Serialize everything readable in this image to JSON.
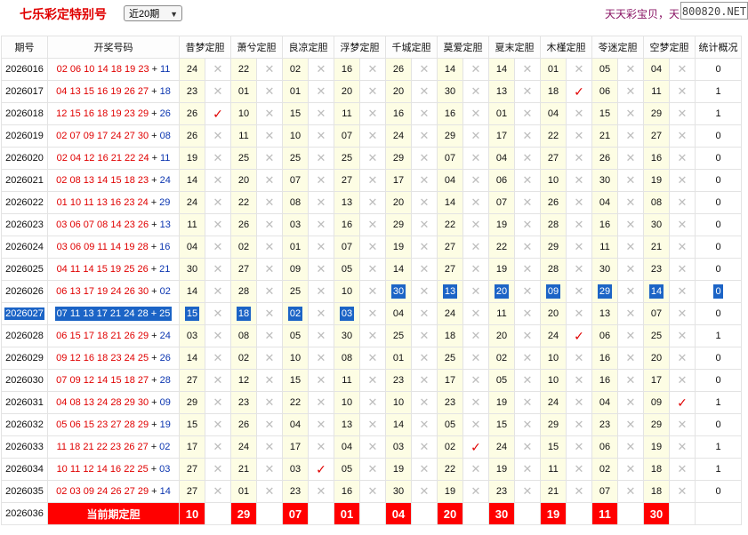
{
  "header": {
    "title": "七乐彩定特别号",
    "period_select": "近20期",
    "slogan": "天天彩宝贝，天",
    "watermark": "800820.NET"
  },
  "table": {
    "col_issue": "期号",
    "col_draw": "开奖号码",
    "predictors": [
      "昔梦定胆",
      "萧兮定胆",
      "良凉定胆",
      "浮梦定胆",
      "千城定胆",
      "莫爱定胆",
      "夏末定胆",
      "木槿定胆",
      "苓迷定胆",
      "空梦定胆"
    ],
    "col_stats": "统计概况",
    "rows": [
      {
        "issue": "2026016",
        "reds": "02 06 10 14 18 19 23",
        "plus": "+",
        "special": "11",
        "picks": [
          "24",
          "22",
          "02",
          "16",
          "26",
          "14",
          "14",
          "01",
          "05",
          "04"
        ],
        "hits": [
          0,
          0,
          0,
          0,
          0,
          0,
          0,
          0,
          0,
          0
        ],
        "stat": "0"
      },
      {
        "issue": "2026017",
        "reds": "04 13 15 16 19 26 27",
        "plus": "+",
        "special": "18",
        "picks": [
          "23",
          "01",
          "01",
          "20",
          "20",
          "30",
          "13",
          "18",
          "06",
          "11"
        ],
        "hits": [
          0,
          0,
          0,
          0,
          0,
          0,
          0,
          1,
          0,
          0
        ],
        "stat": "1"
      },
      {
        "issue": "2026018",
        "reds": "12 15 16 18 19 23 29",
        "plus": "+",
        "special": "26",
        "picks": [
          "26",
          "10",
          "15",
          "11",
          "16",
          "16",
          "01",
          "04",
          "15",
          "29"
        ],
        "hits": [
          1,
          0,
          0,
          0,
          0,
          0,
          0,
          0,
          0,
          0
        ],
        "stat": "1"
      },
      {
        "issue": "2026019",
        "reds": "02 07 09 17 24 27 30",
        "plus": "+",
        "special": "08",
        "picks": [
          "26",
          "11",
          "10",
          "07",
          "24",
          "29",
          "17",
          "22",
          "21",
          "27"
        ],
        "hits": [
          0,
          0,
          0,
          0,
          0,
          0,
          0,
          0,
          0,
          0
        ],
        "stat": "0"
      },
      {
        "issue": "2026020",
        "reds": "02 04 12 16 21 22 24",
        "plus": "+",
        "special": "11",
        "picks": [
          "19",
          "25",
          "25",
          "25",
          "29",
          "07",
          "04",
          "27",
          "26",
          "16"
        ],
        "hits": [
          0,
          0,
          0,
          0,
          0,
          0,
          0,
          0,
          0,
          0
        ],
        "stat": "0"
      },
      {
        "issue": "2026021",
        "reds": "02 08 13 14 15 18 23",
        "plus": "+",
        "special": "24",
        "picks": [
          "14",
          "20",
          "07",
          "27",
          "17",
          "04",
          "06",
          "10",
          "30",
          "19"
        ],
        "hits": [
          0,
          0,
          0,
          0,
          0,
          0,
          0,
          0,
          0,
          0
        ],
        "stat": "0"
      },
      {
        "issue": "2026022",
        "reds": "01 10 11 13 16 23 24",
        "plus": "+",
        "special": "29",
        "picks": [
          "24",
          "22",
          "08",
          "13",
          "20",
          "14",
          "07",
          "26",
          "04",
          "08"
        ],
        "hits": [
          0,
          0,
          0,
          0,
          0,
          0,
          0,
          0,
          0,
          0
        ],
        "stat": "0"
      },
      {
        "issue": "2026023",
        "reds": "03 06 07 08 14 23 26",
        "plus": "+",
        "special": "13",
        "picks": [
          "11",
          "26",
          "03",
          "16",
          "29",
          "22",
          "19",
          "28",
          "16",
          "30"
        ],
        "hits": [
          0,
          0,
          0,
          0,
          0,
          0,
          0,
          0,
          0,
          0
        ],
        "stat": "0"
      },
      {
        "issue": "2026024",
        "reds": "03 06 09 11 14 19 28",
        "plus": "+",
        "special": "16",
        "picks": [
          "04",
          "02",
          "01",
          "07",
          "19",
          "27",
          "22",
          "29",
          "11",
          "21"
        ],
        "hits": [
          0,
          0,
          0,
          0,
          0,
          0,
          0,
          0,
          0,
          0
        ],
        "stat": "0"
      },
      {
        "issue": "2026025",
        "reds": "04 11 14 15 19 25 26",
        "plus": "+",
        "special": "21",
        "picks": [
          "30",
          "27",
          "09",
          "05",
          "14",
          "27",
          "19",
          "28",
          "30",
          "23"
        ],
        "hits": [
          0,
          0,
          0,
          0,
          0,
          0,
          0,
          0,
          0,
          0
        ],
        "stat": "0"
      },
      {
        "issue": "2026026",
        "reds": "06 13 17 19 24 26 30",
        "plus": "+",
        "special": "02",
        "picks": [
          "14",
          "28",
          "25",
          "10",
          "30",
          "13",
          "20",
          "09",
          "29",
          "14"
        ],
        "hits": [
          0,
          0,
          0,
          0,
          0,
          0,
          0,
          0,
          0,
          0
        ],
        "stat": "0"
      },
      {
        "issue": "2026027",
        "reds": "07 11 13 17 21 24 28",
        "plus": "+",
        "special": "25",
        "picks": [
          "15",
          "18",
          "02",
          "03",
          "04",
          "24",
          "11",
          "20",
          "13",
          "07"
        ],
        "hits": [
          0,
          0,
          0,
          0,
          0,
          0,
          0,
          0,
          0,
          0
        ],
        "stat": "0"
      },
      {
        "issue": "2026028",
        "reds": "06 15 17 18 21 26 29",
        "plus": "+",
        "special": "24",
        "picks": [
          "03",
          "08",
          "05",
          "30",
          "25",
          "18",
          "20",
          "24",
          "06",
          "25"
        ],
        "hits": [
          0,
          0,
          0,
          0,
          0,
          0,
          0,
          1,
          0,
          0
        ],
        "stat": "1"
      },
      {
        "issue": "2026029",
        "reds": "09 12 16 18 23 24 25",
        "plus": "+",
        "special": "26",
        "picks": [
          "14",
          "02",
          "10",
          "08",
          "01",
          "25",
          "02",
          "10",
          "16",
          "20"
        ],
        "hits": [
          0,
          0,
          0,
          0,
          0,
          0,
          0,
          0,
          0,
          0
        ],
        "stat": "0"
      },
      {
        "issue": "2026030",
        "reds": "07 09 12 14 15 18 27",
        "plus": "+",
        "special": "28",
        "picks": [
          "27",
          "12",
          "15",
          "11",
          "23",
          "17",
          "05",
          "10",
          "16",
          "17"
        ],
        "hits": [
          0,
          0,
          0,
          0,
          0,
          0,
          0,
          0,
          0,
          0
        ],
        "stat": "0"
      },
      {
        "issue": "2026031",
        "reds": "04 08 13 24 28 29 30",
        "plus": "+",
        "special": "09",
        "picks": [
          "29",
          "23",
          "22",
          "10",
          "10",
          "23",
          "19",
          "24",
          "04",
          "09"
        ],
        "hits": [
          0,
          0,
          0,
          0,
          0,
          0,
          0,
          0,
          0,
          1
        ],
        "stat": "1"
      },
      {
        "issue": "2026032",
        "reds": "05 06 15 23 27 28 29",
        "plus": "+",
        "special": "19",
        "picks": [
          "15",
          "26",
          "04",
          "13",
          "14",
          "05",
          "15",
          "29",
          "23",
          "29"
        ],
        "hits": [
          0,
          0,
          0,
          0,
          0,
          0,
          0,
          0,
          0,
          0
        ],
        "stat": "0"
      },
      {
        "issue": "2026033",
        "reds": "11 18 21 22 23 26 27",
        "plus": "+",
        "special": "02",
        "picks": [
          "17",
          "24",
          "17",
          "04",
          "03",
          "02",
          "24",
          "15",
          "06",
          "19"
        ],
        "hits": [
          0,
          0,
          0,
          0,
          0,
          1,
          0,
          0,
          0,
          0
        ],
        "stat": "1"
      },
      {
        "issue": "2026034",
        "reds": "10 11 12 14 16 22 25",
        "plus": "+",
        "special": "03",
        "picks": [
          "27",
          "21",
          "03",
          "05",
          "19",
          "22",
          "19",
          "11",
          "02",
          "18"
        ],
        "hits": [
          0,
          0,
          1,
          0,
          0,
          0,
          0,
          0,
          0,
          0
        ],
        "stat": "1"
      },
      {
        "issue": "2026035",
        "reds": "02 03 09 24 26 27 29",
        "plus": "+",
        "special": "14",
        "picks": [
          "27",
          "01",
          "23",
          "16",
          "30",
          "19",
          "23",
          "21",
          "07",
          "18"
        ],
        "hits": [
          0,
          0,
          0,
          0,
          0,
          0,
          0,
          0,
          0,
          0
        ],
        "stat": "0"
      }
    ],
    "highlight_rows": [
      10,
      11
    ],
    "current": {
      "issue": "2026036",
      "label": "当前期定胆",
      "picks": [
        "10",
        "29",
        "07",
        "01",
        "04",
        "20",
        "30",
        "19",
        "11",
        "30"
      ]
    },
    "miss_glyph": "✕",
    "hit_glyph": "✓"
  }
}
